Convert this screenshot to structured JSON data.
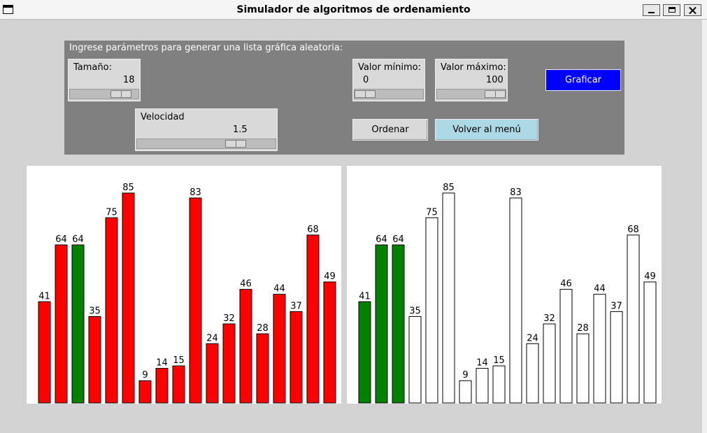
{
  "window": {
    "title": "Simulador de algoritmos de ordenamiento"
  },
  "panel": {
    "heading": "Ingrese parámetros para generar una lista gráfica aleatoria:",
    "size": {
      "label": "Tamaño:",
      "value": "18",
      "fraction": 0.85
    },
    "min": {
      "label": "Valor mínimo:",
      "value": "0",
      "fraction": 0.0
    },
    "max": {
      "label": "Valor máximo:",
      "value": "100",
      "fraction": 1.0
    },
    "speed": {
      "label": "Velocidad",
      "value": "1.5",
      "fraction": 0.75
    },
    "plot_button": "Graficar",
    "sort_button": "Ordenar",
    "menu_button": "Volver al menú"
  },
  "colors": {
    "red": "#ff0000",
    "green": "#008000",
    "white": "#ffffff",
    "blue_button": "#0000ff",
    "menu_button": "#add8e6"
  },
  "chart_data": [
    {
      "type": "bar",
      "values": [
        41,
        64,
        64,
        35,
        75,
        85,
        9,
        14,
        15,
        83,
        24,
        32,
        46,
        28,
        44,
        37,
        68,
        49
      ],
      "bar_colors": [
        "red",
        "red",
        "green",
        "red",
        "red",
        "red",
        "red",
        "red",
        "red",
        "red",
        "red",
        "red",
        "red",
        "red",
        "red",
        "red",
        "red",
        "red"
      ],
      "ylim": [
        0,
        100
      ]
    },
    {
      "type": "bar",
      "values": [
        41,
        64,
        64,
        35,
        75,
        85,
        9,
        14,
        15,
        83,
        24,
        32,
        46,
        28,
        44,
        37,
        68,
        49
      ],
      "bar_colors": [
        "green",
        "green",
        "green",
        "white",
        "white",
        "white",
        "white",
        "white",
        "white",
        "white",
        "white",
        "white",
        "white",
        "white",
        "white",
        "white",
        "white",
        "white"
      ],
      "ylim": [
        0,
        100
      ]
    }
  ]
}
